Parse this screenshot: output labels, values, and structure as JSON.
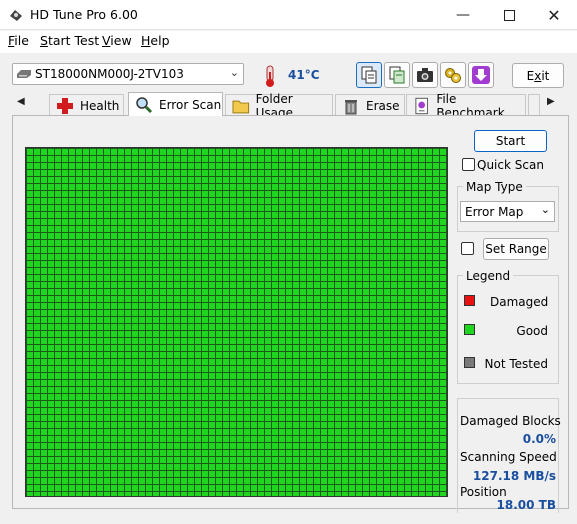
{
  "window": {
    "title": "HD Tune Pro 6.00"
  },
  "menu": [
    {
      "accel": "F",
      "rest": "ile"
    },
    {
      "accel": "S",
      "rest": "tart Test"
    },
    {
      "accel": "V",
      "rest": "iew"
    },
    {
      "accel": "H",
      "rest": "elp"
    }
  ],
  "toolbar": {
    "drive": "ST18000NM000J-2TV103",
    "temperature": "41°C",
    "exit_accel": "x",
    "exit_pre": "E",
    "exit_post": "it"
  },
  "tabs": [
    {
      "label": "Health"
    },
    {
      "label": "Error Scan"
    },
    {
      "label": "Folder Usage"
    },
    {
      "label": "Erase"
    },
    {
      "label": "File Benchmark"
    }
  ],
  "error_scan": {
    "start_label": "Start",
    "quick_scan_label": "Quick Scan",
    "map_type_title": "Map Type",
    "map_type_value": "Error Map",
    "set_range_label": "Set Range",
    "legend_title": "Legend",
    "legend": [
      {
        "label": "Damaged",
        "color": "#e81010"
      },
      {
        "label": "Good",
        "color": "#21d621"
      },
      {
        "label": "Not Tested",
        "color": "#7a7a7a"
      }
    ],
    "stats": {
      "damaged_label": "Damaged Blocks",
      "damaged_value": "0.0%",
      "speed_label": "Scanning Speed",
      "speed_value": "127.18 MB/s",
      "position_label": "Position",
      "position_value": "18.00 TB"
    },
    "block_map": {
      "state": "good",
      "color": "#21d621",
      "line_color": "#1c5a1c"
    }
  }
}
